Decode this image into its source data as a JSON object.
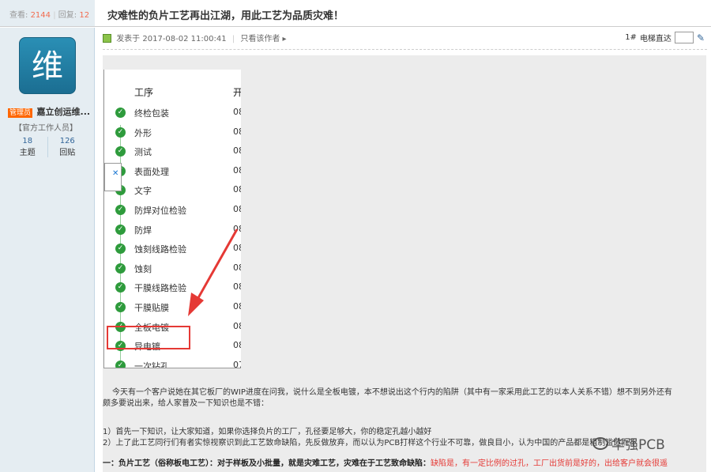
{
  "stats": {
    "views_label": "查看",
    "views": "2144",
    "replies_label": "回复",
    "replies": "12"
  },
  "thread": {
    "title": "灾难性的负片工艺再出江湖，用此工艺为品质灾难！"
  },
  "author": {
    "avatar_text": "维",
    "role_badge": "管理员",
    "name": "嘉立创运维...",
    "group": "【官方工作人员】",
    "topics_count": "18",
    "topics_label": "主题",
    "posts_count": "126",
    "posts_label": "回贴"
  },
  "post": {
    "posted_at": "发表于 2017-08-02 11:00:41",
    "only_author": "只看该作者",
    "floor": "1#",
    "jump_label": "电梯直达",
    "jump_value": ""
  },
  "screenshot": {
    "header_step": "工序",
    "header_col2": "开",
    "steps": [
      {
        "name": "终检包装",
        "v": "08"
      },
      {
        "name": "外形",
        "v": "08"
      },
      {
        "name": "测试",
        "v": "08"
      },
      {
        "name": "表面处理",
        "v": "08"
      },
      {
        "name": "文字",
        "v": "08"
      },
      {
        "name": "防焊对位检验",
        "v": "08"
      },
      {
        "name": "防焊",
        "v": "08"
      },
      {
        "name": "蚀刻线路检验",
        "v": "08"
      },
      {
        "name": "蚀刻",
        "v": "08"
      },
      {
        "name": "干膜线路检验",
        "v": "08"
      },
      {
        "name": "干膜贴膜",
        "v": "08"
      },
      {
        "name": "全板电镀",
        "v": "08"
      },
      {
        "name": "异电镀",
        "v": "08"
      },
      {
        "name": "一次钻孔",
        "v": "07"
      }
    ]
  },
  "body": {
    "p1": "今天有一个客户说她在其它板厂的WIP进度在问我，说什么是全板电镀，本不想说出这个行内的陷阱（其中有一家采用此工艺的以本人关系不错）想不到另外还有",
    "p1b": "颇多要说出来，给人家普及一下知识也是不错：",
    "p2": "1）首先一下知识，让大家知道，如果你选择负片的工厂，孔径要足够大，你的稳定孔越小越好",
    "p3": "2）上了此工艺同行们有者实惊视察识到此工艺致命缺陷，先反做放弃，而以认为PCB打样这个行业不可靠，做良目小，认为中国的产品都是粗制滥造而不",
    "p4_strong": "一：负片工艺（俗称板电工艺）：对于样板及小批量，就是灾难工艺，灾难在于工艺致命缺陷：",
    "p4_red": "缺陷是，有一定比例的过孔，工厂出货前是好的，出给客户就会很遥"
  },
  "watermark": {
    "text": "华强PCB"
  }
}
